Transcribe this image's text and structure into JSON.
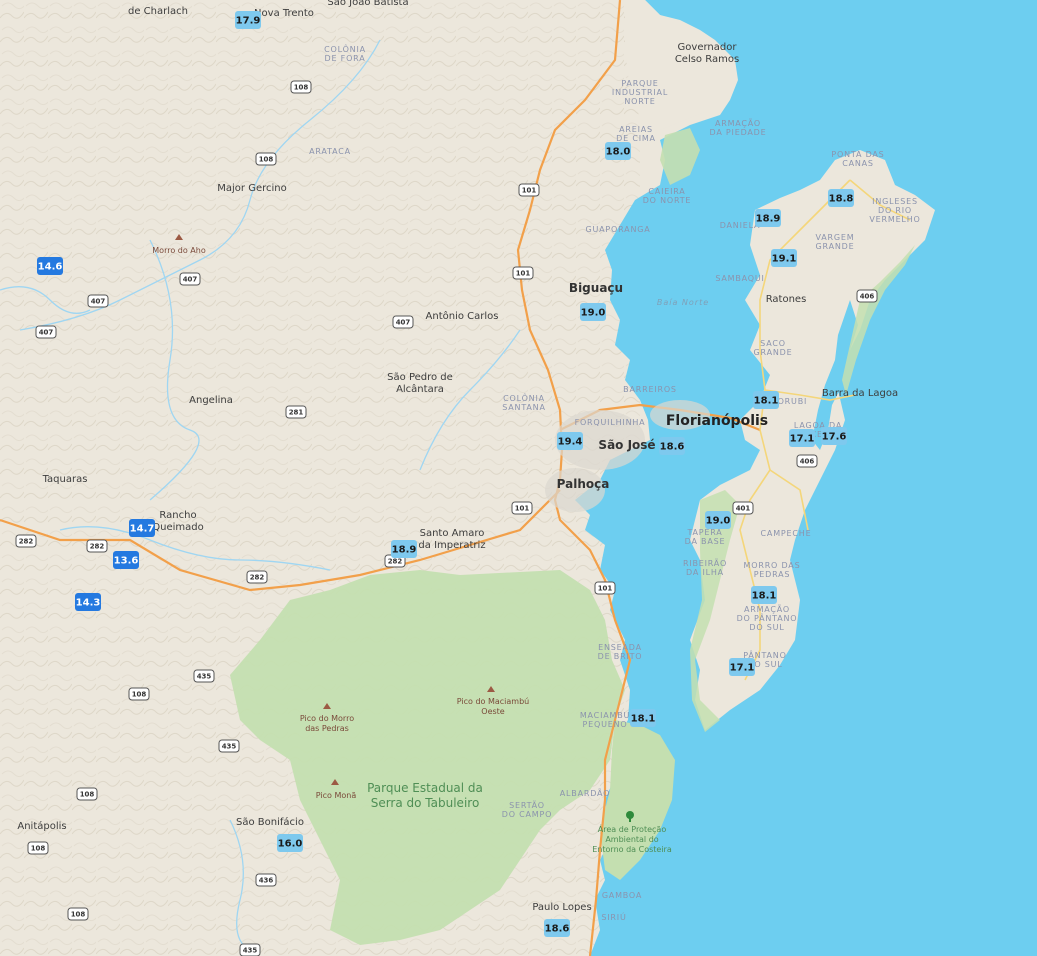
{
  "colors": {
    "land": "#ece7dc",
    "water": "#6dcef0",
    "park": "#c4dfb0",
    "road_main": "#f2a04a",
    "road_secondary": "#f4d67a",
    "marker_warm": "#7ec9ee",
    "marker_cold": "#2479e0"
  },
  "places": [
    {
      "name": "Governador\nCelso Ramos",
      "kind": "city"
    },
    {
      "name": "Biguaçu",
      "kind": "city-big"
    },
    {
      "name": "Florianópolis",
      "kind": "city-huge"
    },
    {
      "name": "São José",
      "kind": "city-big"
    },
    {
      "name": "Palhoça",
      "kind": "city-big"
    },
    {
      "name": "Ratones",
      "kind": "city"
    },
    {
      "name": "Barra da Lagoa",
      "kind": "city"
    },
    {
      "name": "Antônio Carlos",
      "kind": "city"
    },
    {
      "name": "São Pedro de\nAlcântara",
      "kind": "city"
    },
    {
      "name": "Major Gercino",
      "kind": "city"
    },
    {
      "name": "Angelina",
      "kind": "city"
    },
    {
      "name": "Taquaras",
      "kind": "city"
    },
    {
      "name": "Rancho\nQueimado",
      "kind": "city"
    },
    {
      "name": "Santo Amaro\nda Imperatriz",
      "kind": "city"
    },
    {
      "name": "São Bonifácio",
      "kind": "city"
    },
    {
      "name": "Anitápolis",
      "kind": "city"
    },
    {
      "name": "Paulo Lopes",
      "kind": "city"
    },
    {
      "name": "de Charlach",
      "kind": "city"
    },
    {
      "name": "Nova Trento",
      "kind": "city"
    },
    {
      "name": "São João Batista",
      "kind": "city"
    },
    {
      "name": "COLÔNIA\nDE FORA",
      "kind": "hood"
    },
    {
      "name": "ARATACA",
      "kind": "hood"
    },
    {
      "name": "PARQUE\nINDUSTRIAL\nNORTE",
      "kind": "hood"
    },
    {
      "name": "AREIAS\nDE CIMA",
      "kind": "hood"
    },
    {
      "name": "ARMAÇÃO\nDA PIEDADE",
      "kind": "hood"
    },
    {
      "name": "CAIEIRA\nDO NORTE",
      "kind": "hood"
    },
    {
      "name": "GUAPORANGA",
      "kind": "hood"
    },
    {
      "name": "PONTA DAS\nCANAS",
      "kind": "hood"
    },
    {
      "name": "INGLESES\nDO RIO\nVERMELHO",
      "kind": "hood"
    },
    {
      "name": "DANIELA",
      "kind": "hood"
    },
    {
      "name": "VARGEM\nGRANDE",
      "kind": "hood"
    },
    {
      "name": "SAMBAQUI",
      "kind": "hood"
    },
    {
      "name": "SACO\nGRANDE",
      "kind": "hood"
    },
    {
      "name": "BARREIROS",
      "kind": "hood"
    },
    {
      "name": "COLÔNIA\nSANTANA",
      "kind": "hood"
    },
    {
      "name": "FORQUILHINHA",
      "kind": "hood"
    },
    {
      "name": "ITACORUBI",
      "kind": "hood"
    },
    {
      "name": "LAGOA DA\nCONCEIÇÃO",
      "kind": "hood"
    },
    {
      "name": "TAPERA\nDA BASE",
      "kind": "hood"
    },
    {
      "name": "CAMPECHE",
      "kind": "hood"
    },
    {
      "name": "RIBEIRÃO\nDA ILHA",
      "kind": "hood"
    },
    {
      "name": "MORRO DAS\nPEDRAS",
      "kind": "hood"
    },
    {
      "name": "ARMAÇÃO\nDO PÂNTANO\nDO SUL",
      "kind": "hood"
    },
    {
      "name": "PÂNTANO\nDO SUL",
      "kind": "hood"
    },
    {
      "name": "ENSEADA\nDE BRITO",
      "kind": "hood"
    },
    {
      "name": "MACIAMBU\nPEQUENO",
      "kind": "hood"
    },
    {
      "name": "ALBARDÃO",
      "kind": "hood"
    },
    {
      "name": "SERTÃO\nDO CAMPO",
      "kind": "hood"
    },
    {
      "name": "GAMBOA",
      "kind": "hood"
    },
    {
      "name": "SIRIÚ",
      "kind": "hood"
    },
    {
      "name": "Baía Norte",
      "kind": "water"
    },
    {
      "name": "Morro do Aho",
      "kind": "peak"
    },
    {
      "name": "Pico do Morro\ndas Pedras",
      "kind": "peak"
    },
    {
      "name": "Pico do Maciambú\nOeste",
      "kind": "peak"
    },
    {
      "name": "Pico Monã",
      "kind": "peak"
    },
    {
      "name": "Parque Estadual da\nSerra do Tabuleiro",
      "kind": "park"
    },
    {
      "name": "Área de Proteção\nAmbiental do\nEntorno da Costeira",
      "kind": "apa"
    }
  ],
  "road_shields": [
    "108",
    "108",
    "407",
    "407",
    "407",
    "407",
    "101",
    "101",
    "101",
    "101",
    "406",
    "401",
    "406",
    "281",
    "282",
    "282",
    "282",
    "282",
    "435",
    "435",
    "108",
    "108",
    "108",
    "108",
    "436",
    "435"
  ],
  "temperatures": [
    {
      "value": "17.9",
      "tone": "warm"
    },
    {
      "value": "18.0",
      "tone": "warm"
    },
    {
      "value": "18.8",
      "tone": "warm"
    },
    {
      "value": "18.9",
      "tone": "warm"
    },
    {
      "value": "19.1",
      "tone": "warm"
    },
    {
      "value": "19.0",
      "tone": "warm"
    },
    {
      "value": "14.6",
      "tone": "cold"
    },
    {
      "value": "18.1",
      "tone": "warm"
    },
    {
      "value": "17.1",
      "tone": "warm"
    },
    {
      "value": "17.6",
      "tone": "warm"
    },
    {
      "value": "19.4",
      "tone": "warm"
    },
    {
      "value": "18.6",
      "tone": "warm"
    },
    {
      "value": "19.0",
      "tone": "warm"
    },
    {
      "value": "14.7",
      "tone": "cold"
    },
    {
      "value": "13.6",
      "tone": "cold"
    },
    {
      "value": "18.9",
      "tone": "warm"
    },
    {
      "value": "14.3",
      "tone": "cold"
    },
    {
      "value": "18.1",
      "tone": "warm"
    },
    {
      "value": "17.1",
      "tone": "warm"
    },
    {
      "value": "18.1",
      "tone": "warm"
    },
    {
      "value": "16.0",
      "tone": "warm"
    },
    {
      "value": "18.6",
      "tone": "warm"
    }
  ]
}
